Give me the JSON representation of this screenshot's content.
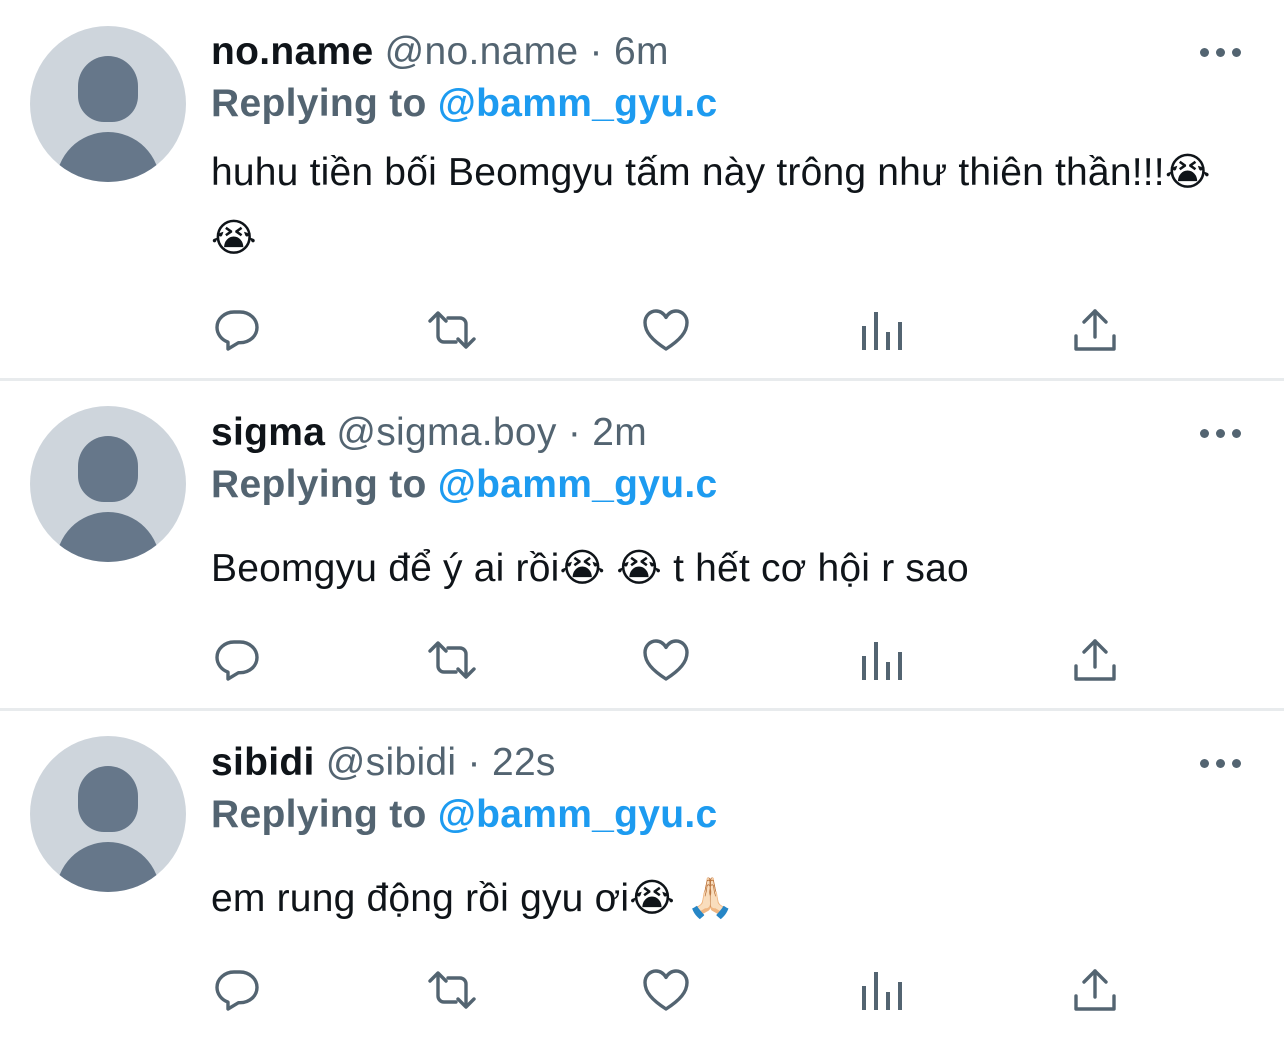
{
  "tweets": [
    {
      "name": "no.name",
      "handle": "@no.name",
      "separator": "·",
      "time": "6m",
      "replying_label": "Replying to",
      "reply_to": "@bamm_gyu.c",
      "text": "huhu tiền bối Beomgyu tấm này trông như thiên thần!!!😭 😭"
    },
    {
      "name": "sigma",
      "handle": "@sigma.boy",
      "separator": "·",
      "time": "2m",
      "replying_label": "Replying to",
      "reply_to": "@bamm_gyu.c",
      "text": "Beomgyu để ý ai rồi😭 😭  t hết cơ hội r sao"
    },
    {
      "name": "sibidi",
      "handle": "@sibidi",
      "separator": "·",
      "time": "22s",
      "replying_label": "Replying to",
      "reply_to": "@bamm_gyu.c",
      "text": "em rung động rồi gyu ơi😭 🙏🏻"
    }
  ],
  "icons": {
    "reply": "reply-icon",
    "retweet": "retweet-icon",
    "like": "like-icon",
    "views": "views-icon",
    "share": "share-icon",
    "more": "more-icon",
    "avatar": "default-avatar-icon"
  },
  "colors": {
    "name": "#0f1419",
    "secondary": "#536471",
    "mention": "#1d9bf0",
    "avatar_bg": "#ced5dc",
    "avatar_fg": "#66778a",
    "divider": "#e8ebed"
  }
}
